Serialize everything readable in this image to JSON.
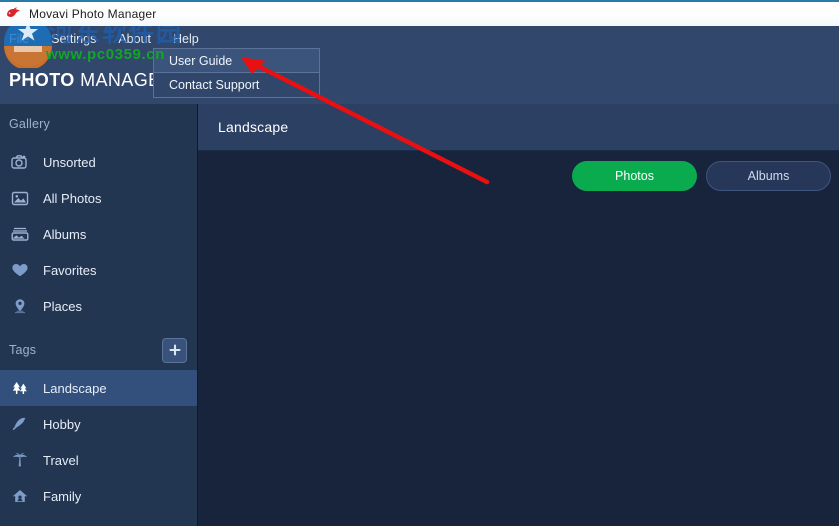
{
  "window": {
    "title": "Movavi Photo Manager",
    "icon": "movavi-bird-icon"
  },
  "menubar": {
    "items": [
      {
        "label": "File",
        "name": "menu-file"
      },
      {
        "label": "Settings",
        "name": "menu-settings"
      },
      {
        "label": "About",
        "name": "menu-about"
      },
      {
        "label": "Help",
        "name": "menu-help"
      }
    ]
  },
  "brand": {
    "bold": "PHOTO",
    "light": " MANAGER"
  },
  "dropdown": {
    "open_for": "Help",
    "items": [
      {
        "label": "User Guide",
        "highlighted": true
      },
      {
        "label": "Contact Support",
        "highlighted": false
      }
    ]
  },
  "sidebar": {
    "gallery_header": "Gallery",
    "gallery_items": [
      {
        "label": "Unsorted",
        "icon": "camera-icon",
        "active": false
      },
      {
        "label": "All Photos",
        "icon": "image-icon",
        "active": false
      },
      {
        "label": "Albums",
        "icon": "album-box-icon",
        "active": false
      },
      {
        "label": "Favorites",
        "icon": "heart-icon",
        "active": false
      },
      {
        "label": "Places",
        "icon": "map-pin-icon",
        "active": false
      }
    ],
    "tags_header": "Tags",
    "add_tag_icon": "plus-icon",
    "tag_items": [
      {
        "label": "Landscape",
        "icon": "trees-icon",
        "active": true
      },
      {
        "label": "Hobby",
        "icon": "shuttlecock-icon",
        "active": false
      },
      {
        "label": "Travel",
        "icon": "palm-tree-icon",
        "active": false
      },
      {
        "label": "Family",
        "icon": "house-icon",
        "active": false
      }
    ]
  },
  "main": {
    "title": "Landscape",
    "tabs": [
      {
        "label": "Photos",
        "style": "primary"
      },
      {
        "label": "Albums",
        "style": "secondary"
      }
    ]
  },
  "watermark": {
    "chinese": "河东软件园",
    "url": "www.pc0359.cn"
  },
  "colors": {
    "accent_green": "#0aab4f",
    "chrome_blue": "#31476b",
    "sidebar_blue": "#223551",
    "content_navy": "#18243c",
    "selected_blue": "#33507c",
    "arrow_red": "#e81010"
  }
}
